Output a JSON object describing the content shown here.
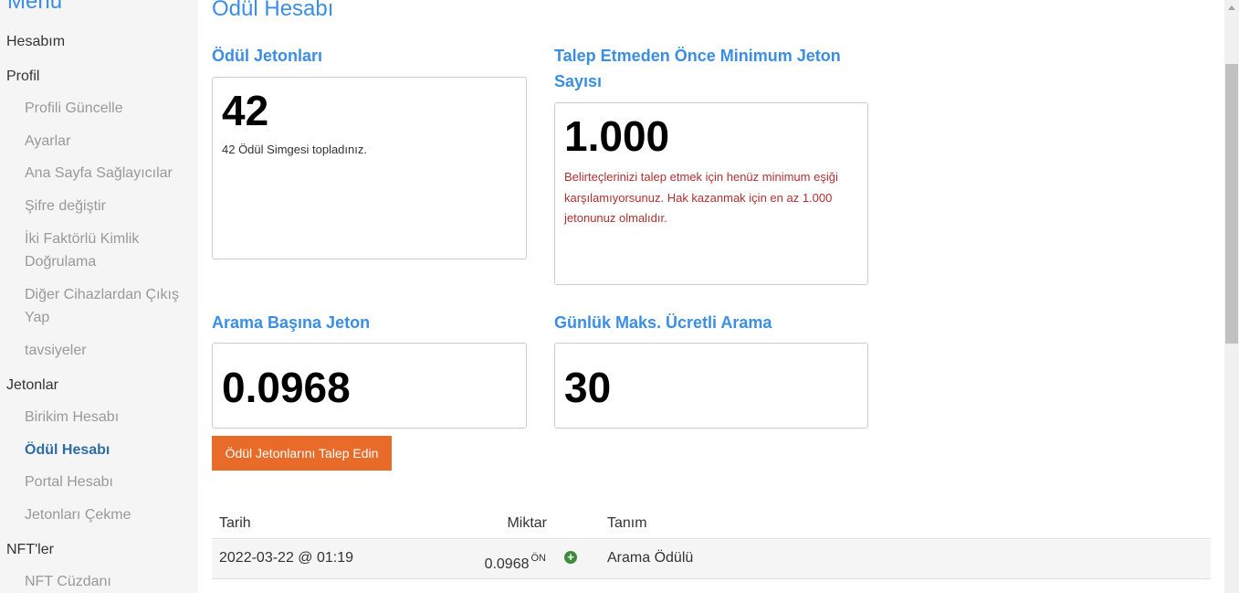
{
  "sidebar": {
    "title": "Menu",
    "items": [
      {
        "label": "Hesabım",
        "type": "section"
      },
      {
        "label": "Profil",
        "type": "section"
      },
      {
        "label": "Profili Güncelle",
        "type": "sub"
      },
      {
        "label": "Ayarlar",
        "type": "sub"
      },
      {
        "label": "Ana Sayfa Sağlayıcılar",
        "type": "sub"
      },
      {
        "label": "Şifre değiştir",
        "type": "sub"
      },
      {
        "label": "İki Faktörlü Kimlik Doğrulama",
        "type": "sub"
      },
      {
        "label": "Diğer Cihazlardan Çıkış Yap",
        "type": "sub"
      },
      {
        "label": "tavsiyeler",
        "type": "sub"
      },
      {
        "label": "Jetonlar",
        "type": "section"
      },
      {
        "label": "Birikim Hesabı",
        "type": "sub"
      },
      {
        "label": "Ödül Hesabı",
        "type": "sub",
        "active": true
      },
      {
        "label": "Portal Hesabı",
        "type": "sub"
      },
      {
        "label": "Jetonları Çekme",
        "type": "sub"
      },
      {
        "label": "NFT'ler",
        "type": "section"
      },
      {
        "label": "NFT Cüzdanı",
        "type": "sub"
      }
    ]
  },
  "main": {
    "page_title": "Ödül Hesabı",
    "cards": {
      "reward_tokens": {
        "title": "Ödül Jetonları",
        "value": "42",
        "note": "42 Ödül Simgesi topladınız."
      },
      "min_tokens": {
        "title": "Talep Etmeden Önce Minimum Jeton Sayısı",
        "value": "1.000",
        "warning": "Belirteçlerinizi talep etmek için henüz minimum eşiği karşılamıyorsunuz. Hak kazanmak için en az 1.000 jetonunuz olmalıdır."
      },
      "per_search": {
        "title": "Arama Başına Jeton",
        "value": "0.0968"
      },
      "daily_max": {
        "title": "Günlük Maks. Ücretli Arama",
        "value": "30"
      }
    },
    "claim_button": "Ödül Jetonlarını Talep Edin",
    "table": {
      "headers": {
        "date": "Tarih",
        "amount": "Miktar",
        "description": "Tanım"
      },
      "rows": [
        {
          "date": "2022-03-22 @ 01:19",
          "amount": "0.0968",
          "unit": "ÖN",
          "icon": "plus-circle-icon",
          "description": "Arama Ödülü"
        }
      ]
    }
  },
  "colors": {
    "accent": "#3a8ee6",
    "button": "#e86b2a",
    "warning": "#b03030",
    "active_nav": "#2e6da4",
    "positive": "#3c8c3c"
  }
}
